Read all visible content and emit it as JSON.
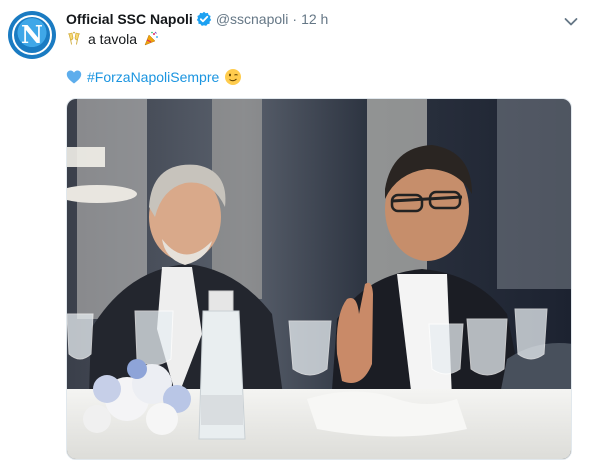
{
  "tweet": {
    "display_name": "Official SSC Napoli",
    "handle": "@sscnapoli",
    "separator": "·",
    "time": "12 h",
    "line1_text": "a tavola",
    "hashtag": "#ForzaNapoliSempre",
    "avatar_letter": "N"
  },
  "icons": {
    "verified": "verified-badge-icon",
    "menu": "chevron-down-icon",
    "toast": "clinking-glasses-emoji",
    "party": "party-popper-emoji",
    "heart": "blue-heart-emoji",
    "wink": "winking-face-emoji"
  },
  "colors": {
    "link": "#1b95e0",
    "secondary_text": "#657786",
    "napoli_blue": "#1a7bc2"
  }
}
